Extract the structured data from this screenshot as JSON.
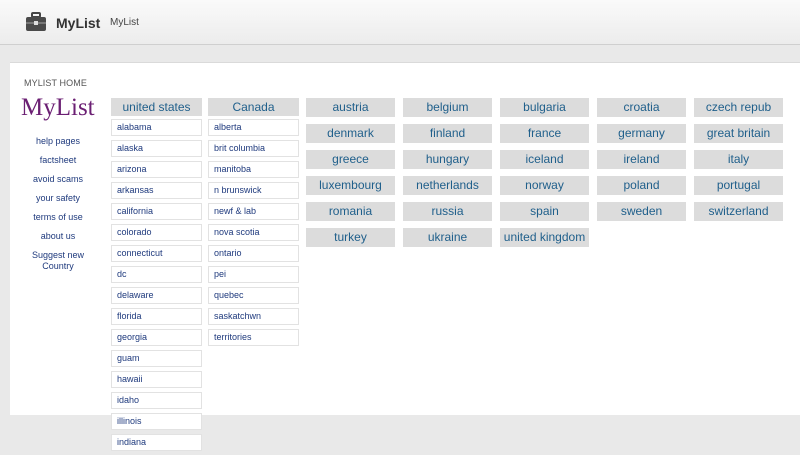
{
  "header": {
    "brand": "MyList",
    "sub": "MyList",
    "icon": "briefcase-icon"
  },
  "page": {
    "home_label": "MYLIST HOME",
    "logo": "MyList"
  },
  "sidebar": {
    "items": [
      "help pages",
      "factsheet",
      "avoid scams",
      "your safety",
      "terms of use",
      "about us",
      "Suggest new Country"
    ]
  },
  "usa": {
    "label": "united states",
    "items": [
      "alabama",
      "alaska",
      "arizona",
      "arkansas",
      "california",
      "colorado",
      "connecticut",
      "dc",
      "delaware",
      "florida",
      "georgia",
      "guam",
      "hawaii",
      "idaho",
      "illinois",
      "indiana"
    ]
  },
  "canada": {
    "label": "Canada",
    "items": [
      "alberta",
      "brit columbia",
      "manitoba",
      "n brunswick",
      "newf & lab",
      "nova scotia",
      "ontario",
      "pei",
      "quebec",
      "saskatchwn",
      "territories"
    ]
  },
  "countries": [
    [
      "austria",
      "belgium",
      "bulgaria",
      "croatia",
      "czech repub"
    ],
    [
      "denmark",
      "finland",
      "france",
      "germany",
      "great britain"
    ],
    [
      "greece",
      "hungary",
      "iceland",
      "ireland",
      "italy"
    ],
    [
      "luxembourg",
      "netherlands",
      "norway",
      "poland",
      "portugal"
    ],
    [
      "romania",
      "russia",
      "spain",
      "sweden",
      "switzerland"
    ],
    [
      "turkey",
      "ukraine",
      "united kingdom"
    ]
  ],
  "colors": {
    "logo": "#6b1f73",
    "link": "#1f3a7d",
    "tile_text": "#1f5f8b",
    "tile_bg": "#dcdcdc"
  }
}
